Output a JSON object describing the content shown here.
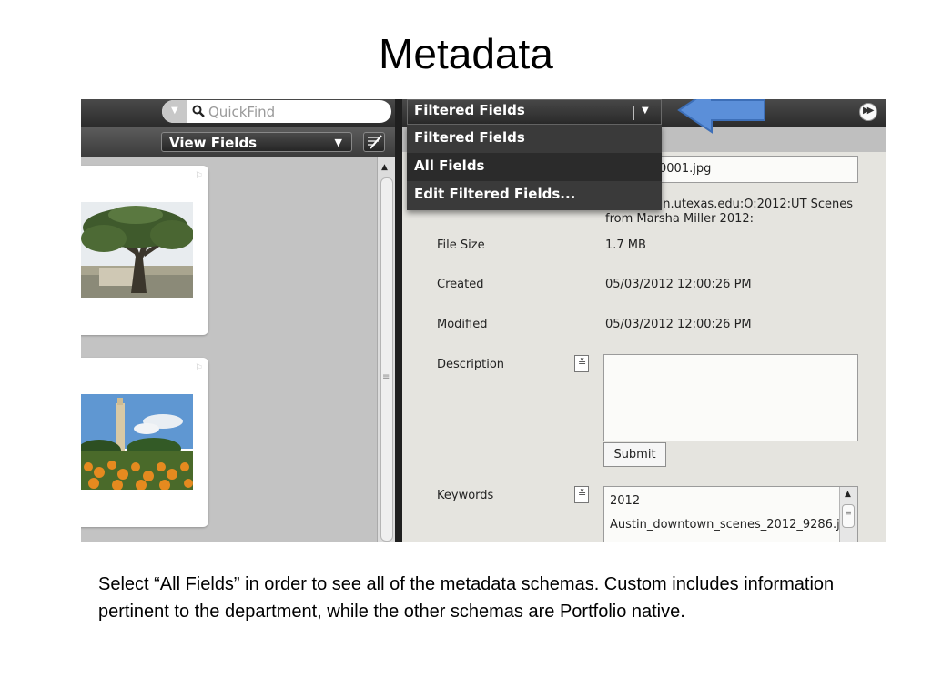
{
  "slide": {
    "title": "Metadata",
    "caption": "Select “All Fields” in order to see all of the metadata schemas. Custom includes information pertinent to the department, while the other schemas are Portfolio native."
  },
  "left_pane": {
    "quickfind_placeholder": "QuickFind",
    "view_fields_label": "View Fields",
    "icons": [
      "chevron-down-icon",
      "search-icon",
      "edit-list-icon",
      "flag-icon",
      "scroll-up-icon"
    ]
  },
  "right_pane": {
    "filter_select_label": "Filtered Fields",
    "dropdown_options": [
      {
        "label": "Filtered Fields"
      },
      {
        "label": "All Fields"
      },
      {
        "label": "Edit Filtered Fields..."
      }
    ],
    "fields": {
      "name_value_fragment": "0001.jpg",
      "path_value": "folio.austin.utexas.edu:O:2012:UT Scenes from Marsha Miller 2012:",
      "file_size_label": "File Size",
      "file_size_value": "1.7 MB",
      "created_label": "Created",
      "created_value": "05/03/2012 12:00:26 PM",
      "modified_label": "Modified",
      "modified_value": "05/03/2012 12:00:26 PM",
      "description_label": "Description",
      "description_value": "",
      "submit_label": "Submit",
      "keywords_label": "Keywords",
      "keywords": [
        "2012",
        "Austin_downtown_scenes_2012_9286.j"
      ]
    }
  },
  "colors": {
    "callout_arrow": "#5b8fd9",
    "toolbar_dark": "#2c2c2c",
    "panel_bg": "#e5e4df"
  }
}
